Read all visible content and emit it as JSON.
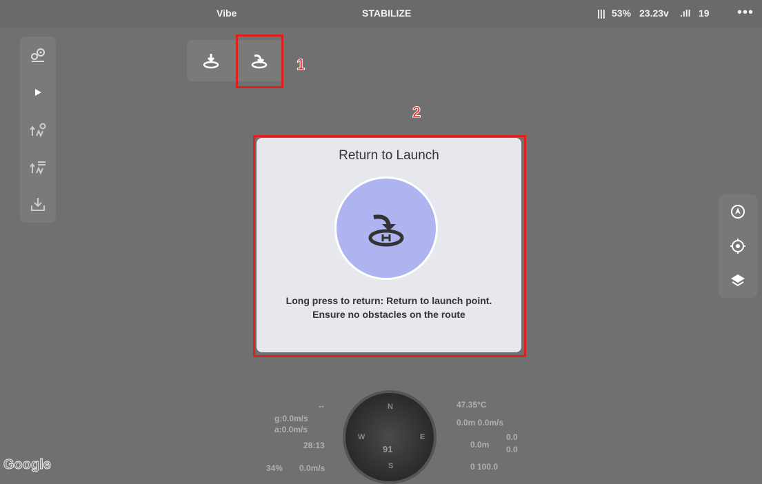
{
  "topbar": {
    "vehicle": "Vibe",
    "mode": "STABILIZE",
    "battery_icon": "|||",
    "battery": "53%",
    "voltage": "23.23v",
    "signal_icon": ".ıll",
    "satellites": "19",
    "more": "•••"
  },
  "left_panel": {
    "items": [
      "map-pin-icon",
      "play-icon",
      "waypoint-upload-icon",
      "waypoint-list-icon",
      "download-icon"
    ]
  },
  "top_toggle": {
    "items": [
      "land-icon",
      "return-to-launch-icon"
    ]
  },
  "annotations": {
    "one": "1",
    "two": "2"
  },
  "dialog": {
    "title": "Return to Launch",
    "message_line1": "Long press to return: Return to launch point.",
    "message_line2": "Ensure no obstacles on the route"
  },
  "right_panel": {
    "items": [
      "locate-drone-icon",
      "locate-me-icon",
      "layers-icon"
    ]
  },
  "telemetry": {
    "dash": "--",
    "gspeed": "g:0.0m/s",
    "aspeed": "a:0.0m/s",
    "time": "28:13",
    "throttle": "34%",
    "vspeed": "0.0m/s",
    "temp": "47.35°C",
    "alt_rel": "0.0m 0.0m/s",
    "alt_home": "0.0m",
    "alt_sub1": "0.0",
    "alt_sub2": "0.0",
    "dist": "0 100.0"
  },
  "compass": {
    "heading": "91",
    "n": "N",
    "e": "E",
    "s": "S",
    "w": "W"
  },
  "map": {
    "attribution": "Google"
  },
  "colors": {
    "highlight": "#e0201b",
    "battery": "#2fbf3b",
    "rtl_button": "#aeb4f0"
  }
}
